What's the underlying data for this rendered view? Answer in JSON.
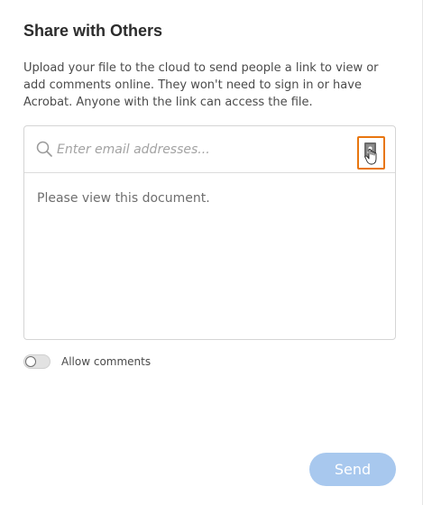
{
  "panel": {
    "title": "Share with Others",
    "description": "Upload your file to the cloud to send people a link to view or add comments online. They won't need to sign in or have Acrobat. Anyone with the link can access the file."
  },
  "recipients": {
    "placeholder": "Enter email addresses...",
    "value": "",
    "contacts_icon": "address-book-icon"
  },
  "message": {
    "value": "Please view this document."
  },
  "allow_comments": {
    "label": "Allow comments",
    "enabled": false
  },
  "actions": {
    "send_label": "Send",
    "send_enabled": false
  },
  "colors": {
    "accent_highlight": "#e8760f",
    "send_disabled": "#a8c8ee"
  }
}
